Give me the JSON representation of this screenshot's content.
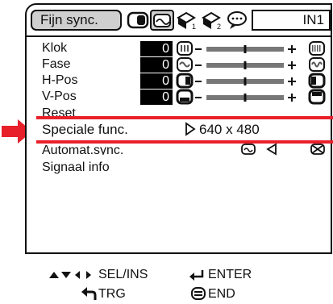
{
  "header": {
    "tab_label": "Fijn sync.",
    "input_label": "IN1",
    "tab_icons": [
      "picture-menu-icon",
      "fine-sync-icon",
      "setup-1-icon",
      "setup-2-icon",
      "language-icon"
    ]
  },
  "menu": {
    "rows": [
      {
        "label": "Klok",
        "value": "0",
        "level": 0.5,
        "icon": "clock-icon"
      },
      {
        "label": "Fase",
        "value": "0",
        "level": 0.5,
        "icon": "phase-icon"
      },
      {
        "label": "H-Pos",
        "value": "0",
        "level": 0.5,
        "icon": "h-position-icon"
      },
      {
        "label": "V-Pos",
        "value": "0",
        "level": 0.5,
        "icon": "v-position-icon"
      }
    ],
    "reset_label": "Reset",
    "special_label": "Speciale func.",
    "special_value": "640 x 480",
    "autosync_label": "Automat.sync.",
    "signal_label": "Signaal info"
  },
  "footer": {
    "sel_ins": "SEL/INS",
    "enter": "ENTER",
    "trg": "TRG",
    "end": "END"
  },
  "colors": {
    "highlight": "#e8202a",
    "tab_bg": "#cfcfcf"
  }
}
